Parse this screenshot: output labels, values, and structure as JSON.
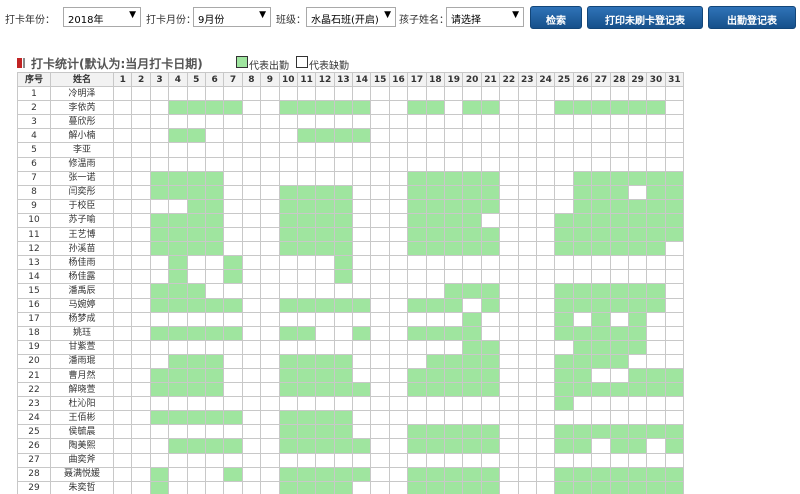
{
  "toolbar": {
    "year_label": "打卡年份：",
    "year_value": "2018年",
    "month_label": "打卡月份：",
    "month_value": "9月份",
    "class_label": "班级：",
    "class_value": "水晶石班(开启)",
    "child_label": "孩子姓名：",
    "child_value": "请选择",
    "search_button": "检索",
    "print_unchecked_button": "打印未刷卡登记表",
    "attendance_register_button": "出勤登记表"
  },
  "section": {
    "title": "打卡统计(默认为:当月打卡日期)",
    "legend_present": "代表出勤",
    "legend_absent": "代表缺勤"
  },
  "colors": {
    "present": "#9fe59f",
    "button": "#1f5c99",
    "title_bar": "#c12424"
  },
  "table": {
    "header_index": "序号",
    "header_name": "姓名",
    "days": [
      "1",
      "2",
      "3",
      "4",
      "5",
      "6",
      "7",
      "8",
      "9",
      "10",
      "11",
      "12",
      "13",
      "14",
      "15",
      "16",
      "17",
      "18",
      "19",
      "20",
      "21",
      "22",
      "23",
      "24",
      "25",
      "26",
      "27",
      "28",
      "29",
      "30",
      "31"
    ],
    "rows": [
      {
        "no": "1",
        "name": "冷明泽",
        "present": []
      },
      {
        "no": "2",
        "name": "李依芮",
        "present": [
          4,
          5,
          6,
          7,
          10,
          11,
          12,
          13,
          14,
          17,
          18,
          20,
          21,
          25,
          26,
          27,
          28,
          29,
          30
        ]
      },
      {
        "no": "3",
        "name": "蔓欣彤",
        "present": []
      },
      {
        "no": "4",
        "name": "解小楠",
        "present": [
          4,
          5,
          11,
          12,
          13,
          14
        ]
      },
      {
        "no": "5",
        "name": "李亚",
        "present": []
      },
      {
        "no": "6",
        "name": "修温雨",
        "present": []
      },
      {
        "no": "7",
        "name": "张一诺",
        "present": [
          3,
          4,
          5,
          6,
          17,
          18,
          19,
          20,
          21,
          26,
          27,
          28,
          29,
          30,
          31
        ]
      },
      {
        "no": "8",
        "name": "闫奕彤",
        "present": [
          3,
          4,
          5,
          6,
          10,
          11,
          12,
          13,
          17,
          18,
          19,
          20,
          21,
          26,
          27,
          28,
          30,
          31
        ]
      },
      {
        "no": "9",
        "name": "于校臣",
        "present": [
          5,
          6,
          10,
          11,
          12,
          13,
          17,
          18,
          19,
          20,
          21,
          26,
          27,
          28,
          29,
          30,
          31
        ]
      },
      {
        "no": "10",
        "name": "苏子喻",
        "present": [
          3,
          4,
          5,
          6,
          10,
          11,
          12,
          13,
          17,
          18,
          19,
          20,
          25,
          26,
          27,
          28,
          29,
          30,
          31
        ]
      },
      {
        "no": "11",
        "name": "王艺博",
        "present": [
          3,
          4,
          5,
          6,
          10,
          11,
          12,
          13,
          17,
          18,
          19,
          20,
          21,
          25,
          26,
          27,
          28,
          29,
          30,
          31
        ]
      },
      {
        "no": "12",
        "name": "孙溪苗",
        "present": [
          3,
          4,
          5,
          6,
          10,
          11,
          12,
          13,
          17,
          18,
          19,
          20,
          21,
          25,
          26,
          27,
          28,
          29,
          30
        ]
      },
      {
        "no": "13",
        "name": "杨佳雨",
        "present": [
          4,
          7,
          13
        ]
      },
      {
        "no": "14",
        "name": "杨佳露",
        "present": [
          4,
          7,
          13
        ]
      },
      {
        "no": "15",
        "name": "潘禹辰",
        "present": [
          3,
          4,
          5,
          19,
          20,
          21,
          25,
          26,
          27,
          28,
          29,
          30
        ]
      },
      {
        "no": "16",
        "name": "马婉婷",
        "present": [
          3,
          4,
          5,
          6,
          7,
          10,
          11,
          12,
          13,
          14,
          17,
          18,
          19,
          21,
          25,
          26,
          27,
          28,
          29,
          30
        ]
      },
      {
        "no": "17",
        "name": "杨梦成",
        "present": [
          20,
          25,
          27,
          29
        ]
      },
      {
        "no": "18",
        "name": "姚珏",
        "present": [
          3,
          4,
          5,
          6,
          7,
          10,
          11,
          14,
          17,
          18,
          19,
          20,
          25,
          26,
          27,
          28,
          29
        ]
      },
      {
        "no": "19",
        "name": "甘紫萱",
        "present": [
          20,
          21,
          26,
          27,
          28,
          29
        ]
      },
      {
        "no": "20",
        "name": "潘雨琨",
        "present": [
          4,
          5,
          6,
          10,
          11,
          12,
          13,
          18,
          19,
          20,
          21,
          25,
          26,
          27,
          28
        ]
      },
      {
        "no": "21",
        "name": "曹月然",
        "present": [
          3,
          4,
          5,
          6,
          10,
          11,
          12,
          13,
          17,
          18,
          19,
          20,
          21,
          25,
          26,
          29,
          30,
          31
        ]
      },
      {
        "no": "22",
        "name": "解晓萱",
        "present": [
          3,
          4,
          5,
          6,
          10,
          11,
          12,
          13,
          14,
          17,
          18,
          19,
          20,
          21,
          25,
          26,
          27,
          28,
          29,
          30,
          31
        ]
      },
      {
        "no": "23",
        "name": "杜沁阳",
        "present": [
          25
        ]
      },
      {
        "no": "24",
        "name": "王佰彬",
        "present": [
          3,
          4,
          5,
          6,
          7,
          10,
          11,
          12,
          13
        ]
      },
      {
        "no": "25",
        "name": "侯毓晨",
        "present": [
          10,
          11,
          12,
          13,
          17,
          18,
          19,
          20,
          21,
          25,
          26,
          27,
          28,
          29,
          30,
          31
        ]
      },
      {
        "no": "26",
        "name": "陶美熙",
        "present": [
          4,
          5,
          6,
          7,
          10,
          11,
          12,
          13,
          14,
          17,
          18,
          19,
          20,
          21,
          25,
          26,
          28,
          29,
          31
        ]
      },
      {
        "no": "27",
        "name": "曲奕斧",
        "present": []
      },
      {
        "no": "28",
        "name": "聂满悦媛",
        "present": [
          3,
          7,
          10,
          11,
          12,
          13,
          14,
          17,
          18,
          19,
          20,
          21,
          25,
          26,
          27,
          28,
          29,
          30,
          31
        ]
      },
      {
        "no": "29",
        "name": "朱奕哲",
        "present": [
          3,
          10,
          11,
          12,
          13,
          17,
          18,
          19,
          20,
          21,
          25,
          26,
          27,
          28,
          29,
          30,
          31
        ]
      }
    ]
  }
}
